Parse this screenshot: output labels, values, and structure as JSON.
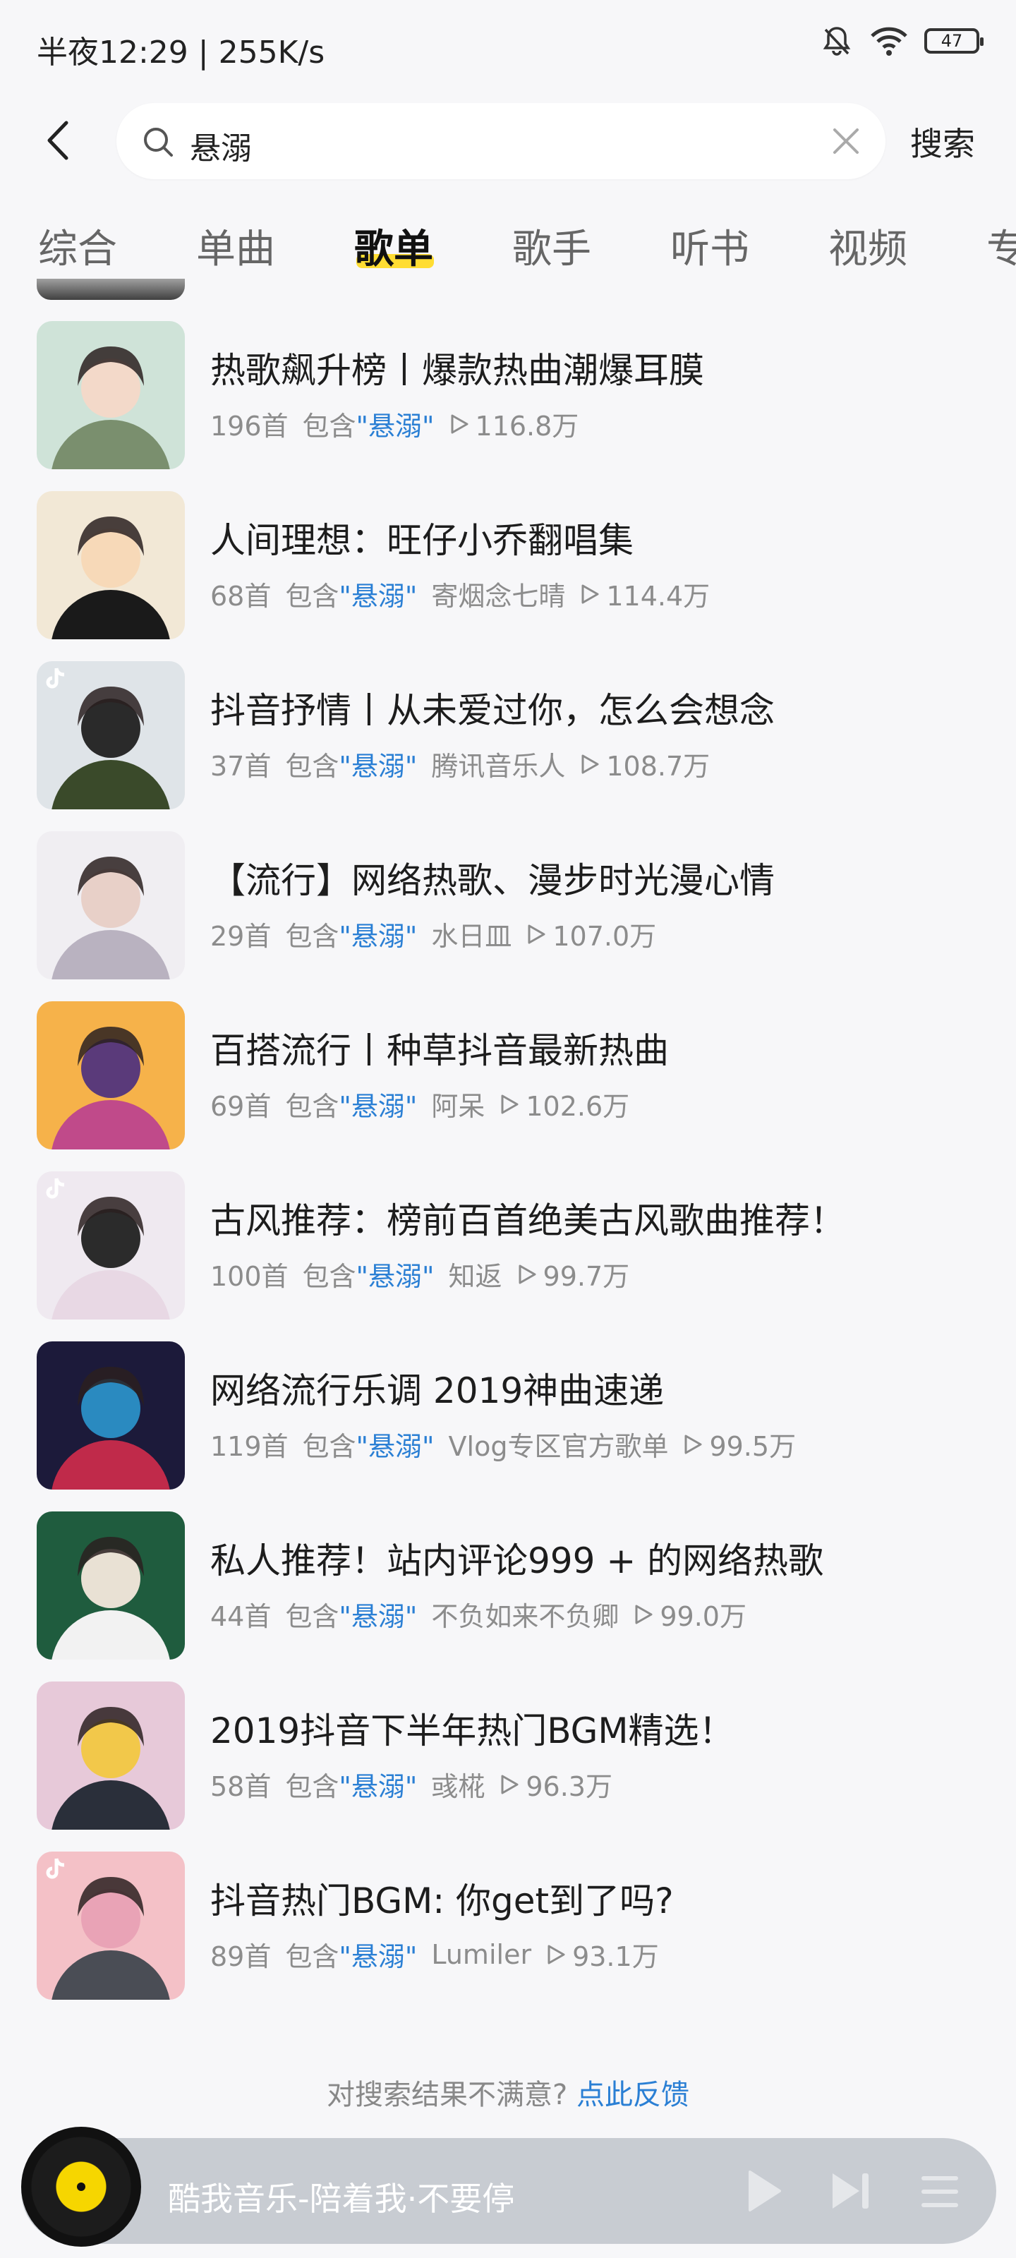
{
  "status_bar": {
    "time": "半夜12:29 | 255K/s",
    "battery": "47"
  },
  "search": {
    "query": "悬溺",
    "button_label": "搜索"
  },
  "tabs": [
    {
      "label": "综合"
    },
    {
      "label": "单曲"
    },
    {
      "label": "歌单",
      "active": true
    },
    {
      "label": "歌手"
    },
    {
      "label": "听书"
    },
    {
      "label": "视频"
    },
    {
      "label": "专"
    }
  ],
  "meta_keyword": {
    "prefix": "包含",
    "keyword": "\"悬溺\""
  },
  "playlists": [
    {
      "title": "热歌飙升榜丨爆款热曲潮爆耳膜",
      "count": "196首",
      "author": "",
      "plays": "116.8万"
    },
    {
      "title": "人间理想：旺仔小乔翻唱集",
      "count": "68首",
      "author": "寄烟念七晴",
      "plays": "114.4万"
    },
    {
      "title": "抖音抒情丨从未爱过你，怎么会想念",
      "count": "37首",
      "author": "腾讯音乐人",
      "plays": "108.7万"
    },
    {
      "title": "【流行】网络热歌、漫步时光漫心情",
      "count": "29首",
      "author": "水日皿",
      "plays": "107.0万"
    },
    {
      "title": "百搭流行丨种草抖音最新热曲",
      "count": "69首",
      "author": "阿呆",
      "plays": "102.6万"
    },
    {
      "title": "古风推荐：榜前百首绝美古风歌曲推荐！",
      "count": "100首",
      "author": "知返",
      "plays": "99.7万"
    },
    {
      "title": "网络流行乐调 2019神曲速递",
      "count": "119首",
      "author": "Vlog专区官方歌单",
      "plays": "99.5万"
    },
    {
      "title": "私人推荐！站内评论999 + 的网络热歌",
      "count": "44首",
      "author": "不负如来不负卿",
      "plays": "99.0万"
    },
    {
      "title": "2019抖音下半年热门BGM精选！",
      "count": "58首",
      "author": "彧椛",
      "plays": "96.3万"
    },
    {
      "title": "抖音热门BGM: 你get到了吗?",
      "count": "89首",
      "author": "Lumiler",
      "plays": "93.1万"
    }
  ],
  "feedback": {
    "text": "对搜索结果不满意?",
    "link": "点此反馈"
  },
  "player": {
    "text": "酷我音乐-陪着我·不要停"
  },
  "colors": {
    "accent": "#2a7fd4",
    "tab_highlight": "#ffdd33",
    "player_bg": "#c8ccd2"
  },
  "icons": [
    "back-icon",
    "search-icon",
    "clear-icon",
    "mute-bell-icon",
    "wifi-icon",
    "battery-icon",
    "play-count-icon",
    "tiktok-icon",
    "play-icon",
    "next-icon",
    "playlist-icon"
  ]
}
